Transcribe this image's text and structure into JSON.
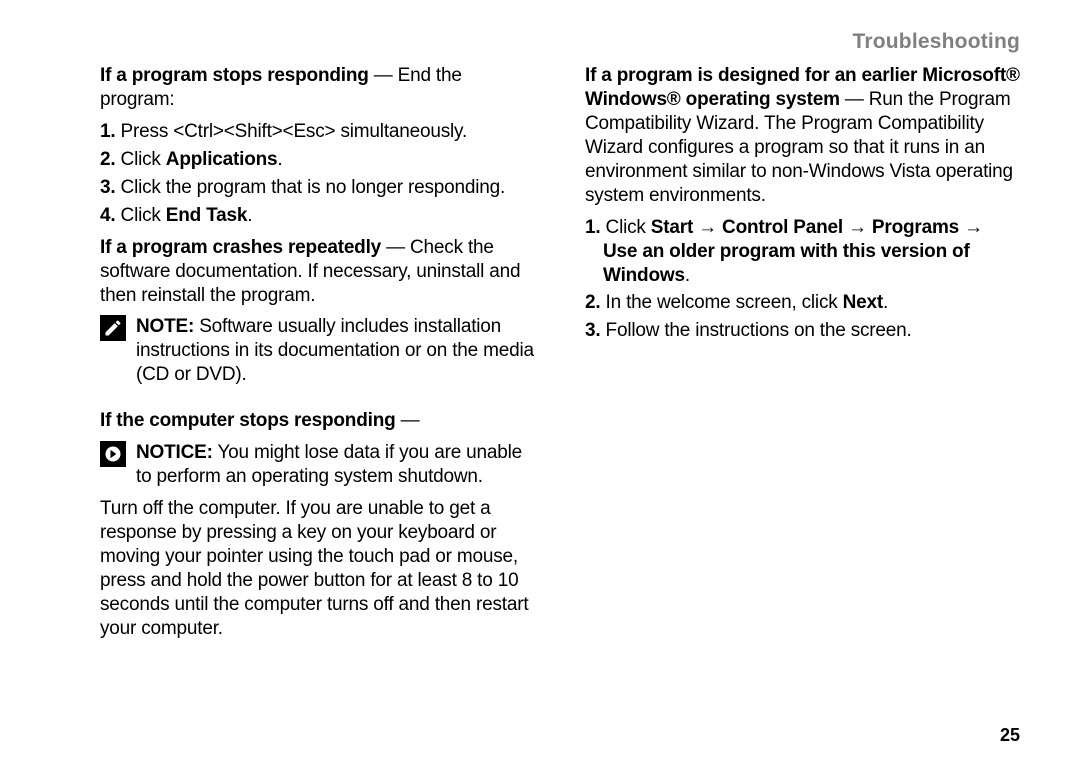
{
  "header": {
    "title": "Troubleshooting"
  },
  "page_number": "25",
  "left": {
    "h1_lead": "If a program stops responding",
    "h1_lead_dash": " — ",
    "h1_after": "End the program:",
    "steps1": [
      {
        "n": "1.",
        "pre": "Press <Ctrl><Shift><Esc> simultaneously."
      },
      {
        "n": "2.",
        "pre": "Click ",
        "bold": "Applications",
        "post": "."
      },
      {
        "n": "3.",
        "pre": "Click the program that is no longer responding."
      },
      {
        "n": "4.",
        "pre": "Click ",
        "bold": "End Task",
        "post": "."
      }
    ],
    "h2_lead": "If a program crashes repeatedly",
    "h2_dash": " — ",
    "h2_after": "Check the software documentation. If necessary, uninstall and then reinstall the program.",
    "note1_label": "NOTE:",
    "note1_text": " Software usually includes installation instructions in its documentation or on the media (CD or DVD).",
    "h3_lead": "If the computer stops responding",
    "h3_dash": " —",
    "notice_label": "NOTICE:",
    "notice_text": " You might lose data if you are unable to perform an operating system shutdown.",
    "p_last": "Turn off the computer. If you are unable to get a response by pressing a key on your keyboard or moving your pointer using the touch pad or mouse, press and hold the power button for at least 8 to 10 seconds until the computer turns off and then restart your computer."
  },
  "right": {
    "h1_lead": "If a program is designed for an earlier Microsoft® Windows® operating system",
    "h1_dash": " — ",
    "h1_after": "Run the Program Compatibility Wizard. The Program Compatibility Wizard configures a program so that it runs in an environment similar to non-Windows Vista operating system environments.",
    "steps": [
      {
        "n": "1.",
        "pre": "Click ",
        "bold": "Start → Control Panel → Programs → Use an older program with this version of Windows",
        "post": "."
      },
      {
        "n": "2.",
        "pre": "In the welcome screen, click ",
        "bold": "Next",
        "post": "."
      },
      {
        "n": "3.",
        "pre": "Follow the instructions on the screen."
      }
    ]
  }
}
